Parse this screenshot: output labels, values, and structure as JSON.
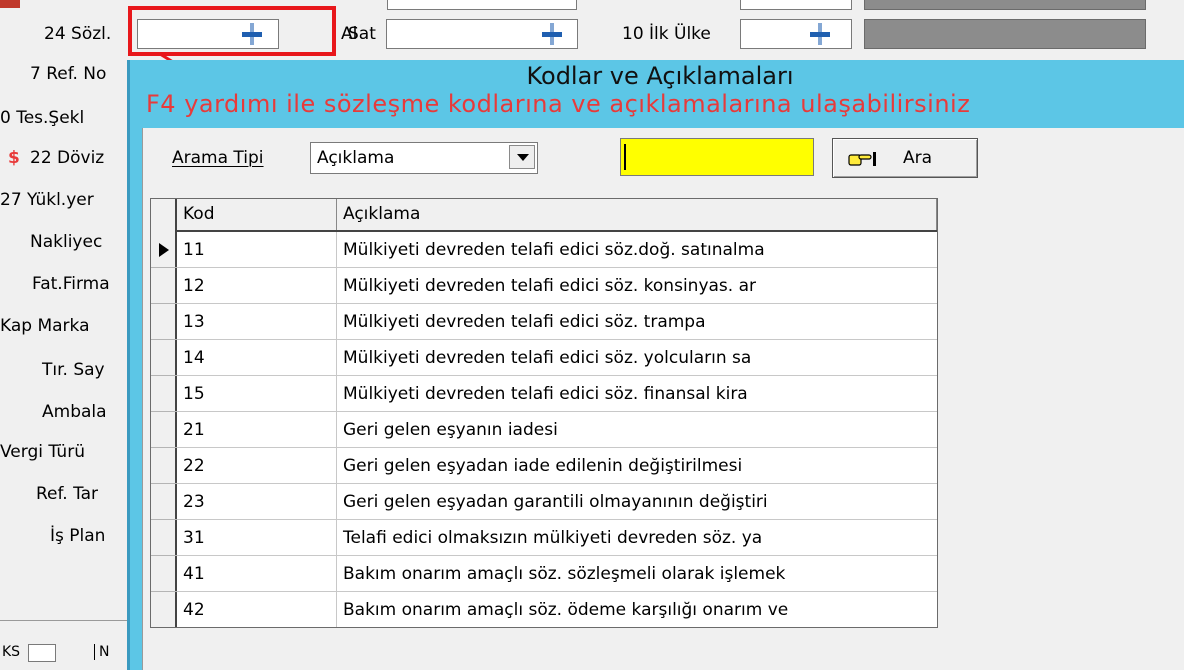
{
  "top_bar": {
    "field_24_label": "24 Sözl.",
    "field_24_value": "",
    "al_label": "Al",
    "sat_label": "Sat",
    "sat_value": "",
    "field_10_label": "10 İlk Ülke",
    "field_10_value": ""
  },
  "left_labels": [
    "7 Ref. No",
    "0 Tes.Şekl",
    "22 Döviz",
    "27 Yükl.yer",
    "Nakliyec",
    "Fat.Firma",
    "Kap Marka",
    "Tır. Say",
    "Ambala",
    "Vergi Türü",
    "Ref. Tar",
    "İş Plan"
  ],
  "bottom_left": {
    "ks_label": "KS",
    "n_label": "N"
  },
  "dialog": {
    "title": "Kodlar ve Açıklamaları",
    "hint": "F4 yardımı ile sözleşme kodlarına ve açıklamalarına ulaşabilirsiniz",
    "search_type_label": "Arama Tipi",
    "search_type_value": "Açıklama",
    "search_value": "",
    "search_button_label": "Ara",
    "columns": [
      "Kod",
      "Açıklama"
    ],
    "rows": [
      {
        "kod": "11",
        "aciklama": "Mülkiyeti devreden telafi edici söz.doğ. satınalma"
      },
      {
        "kod": "12",
        "aciklama": "Mülkiyeti devreden telafi edici söz. konsinyas. ar"
      },
      {
        "kod": "13",
        "aciklama": "Mülkiyeti devreden telafi edici söz. trampa"
      },
      {
        "kod": "14",
        "aciklama": "Mülkiyeti devreden telafi edici söz. yolcuların sa"
      },
      {
        "kod": "15",
        "aciklama": "Mülkiyeti devreden telafi edici söz. finansal kira"
      },
      {
        "kod": "21",
        "aciklama": "Geri gelen eşyanın iadesi"
      },
      {
        "kod": "22",
        "aciklama": "Geri gelen eşyadan iade edilenin değiştirilmesi"
      },
      {
        "kod": "23",
        "aciklama": "Geri gelen eşyadan garantili olmayanının değiştiri"
      },
      {
        "kod": "31",
        "aciklama": "Telafi edici olmaksızın mülkiyeti devreden söz. ya"
      },
      {
        "kod": "41",
        "aciklama": "Bakım onarım amaçlı söz. sözleşmeli olarak işlemek"
      },
      {
        "kod": "42",
        "aciklama": "Bakım onarım amaçlı söz. ödeme karşılığı onarım ve"
      }
    ],
    "selected_row": 0
  },
  "colors": {
    "dialog_bg": "#5cc6e6",
    "hint_text": "#e83a3a",
    "highlight_box": "#e8171b",
    "search_box": "#ffff00",
    "currency_icon": "#e83a3a"
  },
  "icons": {
    "lookup": "lookup-bar-icon",
    "row_pointer": "row-pointer-icon",
    "search_button": "pointing-hand-icon",
    "currency": "dollar-icon"
  }
}
